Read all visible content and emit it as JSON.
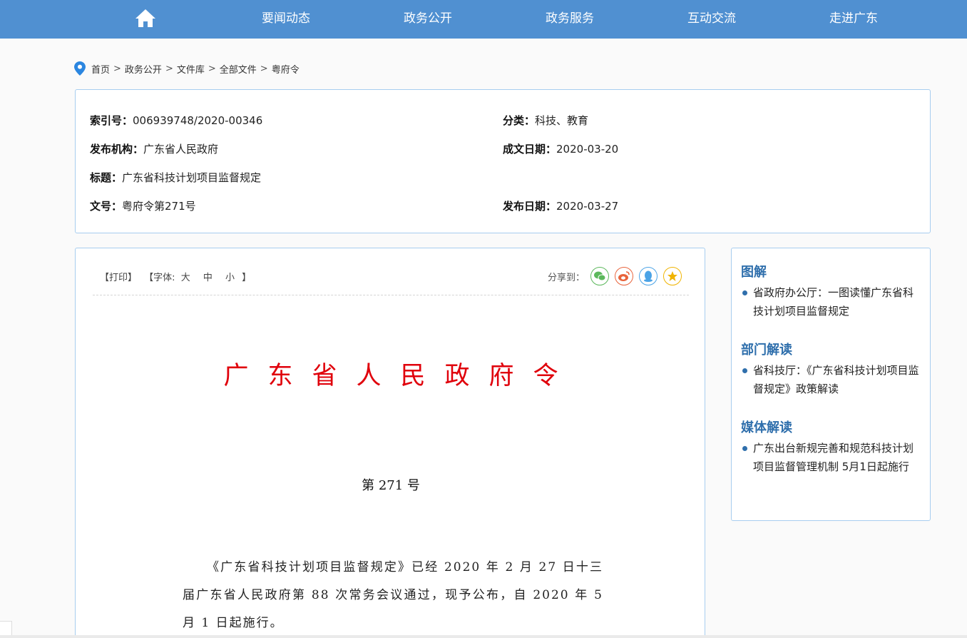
{
  "nav": {
    "home_icon": "home-icon",
    "items": [
      {
        "label": "要闻动态"
      },
      {
        "label": "政务公开"
      },
      {
        "label": "政务服务"
      },
      {
        "label": "互动交流"
      },
      {
        "label": "走进广东"
      }
    ],
    "bg_color": "#5090d1"
  },
  "breadcrumb": {
    "icon": "location-pin-icon",
    "items": [
      "首页",
      "政务公开",
      "文件库",
      "全部文件",
      "粤府令"
    ],
    "separator": ">"
  },
  "meta": {
    "index_label": "索引号：",
    "index_value": "006939748/2020-00346",
    "category_label": "分类：",
    "category_value": "科技、教育",
    "issuer_label": "发布机构：",
    "issuer_value": "广东省人民政府",
    "written_label": "成文日期：",
    "written_value": "2020-03-20",
    "title_label": "标题：",
    "title_value": "广东省科技计划项目监督规定",
    "docno_label": "文号：",
    "docno_value": "粤府令第271号",
    "published_label": "发布日期：",
    "published_value": "2020-03-27"
  },
  "toolbar": {
    "print": "【打印】",
    "font_prefix": "【字体:",
    "font_large": "大",
    "font_medium": "中",
    "font_small": "小",
    "font_suffix": "】",
    "share_label": "分享到：",
    "share_icons": [
      "wechat-icon",
      "weibo-icon",
      "qq-icon",
      "qzone-icon"
    ]
  },
  "document": {
    "title": "广东省人民政府令",
    "number": "第 271 号",
    "body": "《广东省科技计划项目监督规定》已经 2020 年 2 月 27 日十三届广东省人民政府第 88 次常务会议通过，现予公布，自 2020 年 5 月 1 日起施行。",
    "title_color": "#e0000b"
  },
  "sidebar": {
    "sections": [
      {
        "heading": "图解",
        "items": [
          "省政府办公厅：一图读懂广东省科技计划项目监督规定"
        ]
      },
      {
        "heading": "部门解读",
        "items": [
          "省科技厅：《广东省科技计划项目监督规定》政策解读"
        ]
      },
      {
        "heading": "媒体解读",
        "items": [
          "广东出台新规完善和规范科技计划项目监督管理机制  5月1日起施行"
        ]
      }
    ],
    "heading_color": "#2f6fac"
  }
}
